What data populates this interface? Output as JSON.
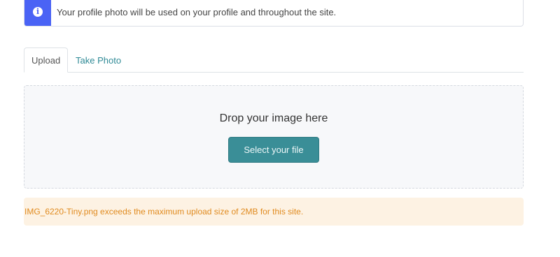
{
  "info_alert": {
    "icon": "info-icon",
    "text": "Your profile photo will be used on your profile and throughout the site."
  },
  "tabs": [
    {
      "label": "Upload",
      "active": true
    },
    {
      "label": "Take Photo",
      "active": false
    }
  ],
  "dropzone": {
    "title": "Drop your image here",
    "button_label": "Select your file"
  },
  "warning": {
    "text": "IMG_6220-Tiny.png exceeds the maximum upload size of 2MB for this site."
  },
  "colors": {
    "info_accent": "#4a63f5",
    "link": "#2f8a96",
    "button": "#3a8e97",
    "warning_bg": "#fdf2e3",
    "warning_text": "#e08a1e"
  }
}
